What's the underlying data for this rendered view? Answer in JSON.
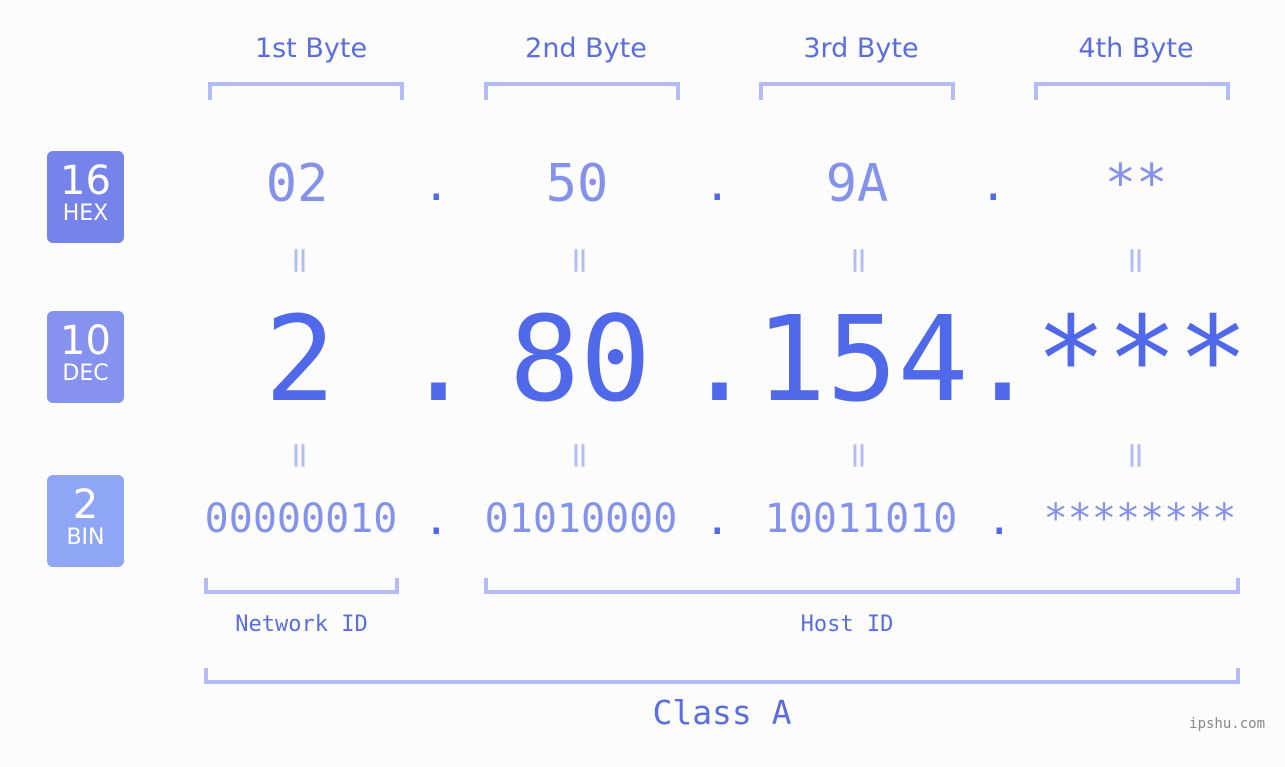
{
  "bytes": [
    {
      "label": "1st Byte",
      "hex": "02",
      "dec": "2",
      "bin": "00000010"
    },
    {
      "label": "2nd Byte",
      "hex": "50",
      "dec": "80",
      "bin": "01010000"
    },
    {
      "label": "3rd Byte",
      "hex": "9A",
      "dec": "154",
      "bin": "10011010"
    },
    {
      "label": "4th Byte",
      "hex": "**",
      "dec": "***",
      "bin": "********"
    }
  ],
  "bases": {
    "hex": {
      "num": "16",
      "label": "HEX",
      "color": "#7683ea"
    },
    "dec": {
      "num": "10",
      "label": "DEC",
      "color": "#8592ef"
    },
    "bin": {
      "num": "2",
      "label": "BIN",
      "color": "#8fa5f6"
    }
  },
  "separator": ".",
  "equals": "=",
  "network_id": "Network ID",
  "host_id": "Host ID",
  "ip_class": "Class A",
  "watermark": "ipshu.com"
}
